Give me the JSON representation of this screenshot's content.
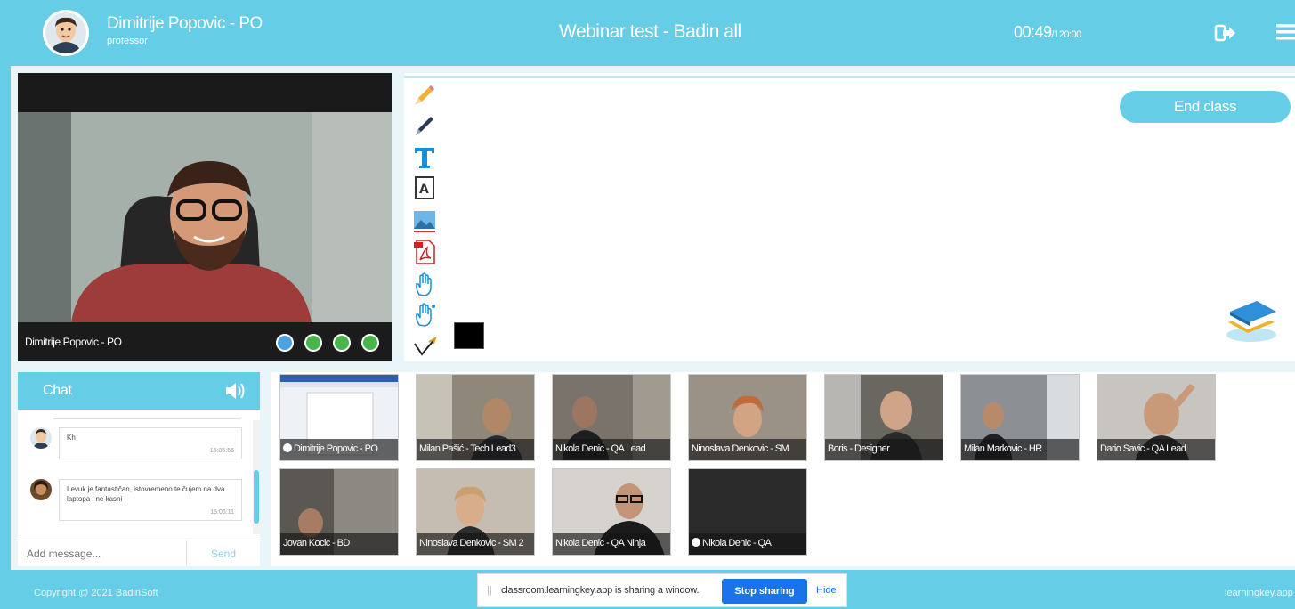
{
  "header": {
    "user_name": "Dimitrije Popovic - PO",
    "user_role": "professor",
    "title": "Webinar test - Badin all",
    "timer_elapsed": "00:49",
    "timer_total": "/120:00"
  },
  "main_video": {
    "label": "Dimitrije Popovic - PO"
  },
  "whiteboard": {
    "end_class_label": "End class",
    "tools": [
      "pencil-icon",
      "pen-icon",
      "text-icon",
      "text-box-icon",
      "image-icon",
      "pdf-icon",
      "hand-icon",
      "hand-pointer-icon",
      "line-icon"
    ],
    "selected_color": "#000000"
  },
  "chat": {
    "title": "Chat",
    "messages": [
      {
        "text": "Kh",
        "time": "15:05:56"
      },
      {
        "text": "Levuk je fantastičan, istovremeno te čujem na dva laptopa i ne kasni",
        "time": "15:06:11"
      }
    ],
    "input_placeholder": "Add message...",
    "send_label": "Send"
  },
  "participants": [
    {
      "name": "Dimitrije Popovic - PO",
      "bg": "#e8edf2"
    },
    {
      "name": "Milan Pašić - Tech Lead3",
      "bg": "#7d766b"
    },
    {
      "name": "Nikola Denic - QA Lead",
      "bg": "#6b6560"
    },
    {
      "name": "Ninoslava Denkovic - SM",
      "bg": "#8a8278"
    },
    {
      "name": "Boris - Designer",
      "bg": "#5d5a56"
    },
    {
      "name": "Milan Markovic - HR",
      "bg": "#7b7f84"
    },
    {
      "name": "Dario Savic - QA Lead",
      "bg": "#6a6461"
    },
    {
      "name": "Jovan Kocic - BD",
      "bg": "#4d4a47"
    },
    {
      "name": "Ninoslava Denkovic - SM 2",
      "bg": "#b8b1a6"
    },
    {
      "name": "Nikola Denic - QA Ninja",
      "bg": "#c9c6c2"
    },
    {
      "name": "Nikola Denic - QA",
      "bg": "#2a2a2a"
    }
  ],
  "footer": {
    "copyright": "Copyright @ 2021 BadinSoft",
    "right_text": "learningkey.app",
    "share_text": "classroom.learningkey.app is sharing a window.",
    "stop_sharing": "Stop sharing",
    "hide": "Hide"
  }
}
